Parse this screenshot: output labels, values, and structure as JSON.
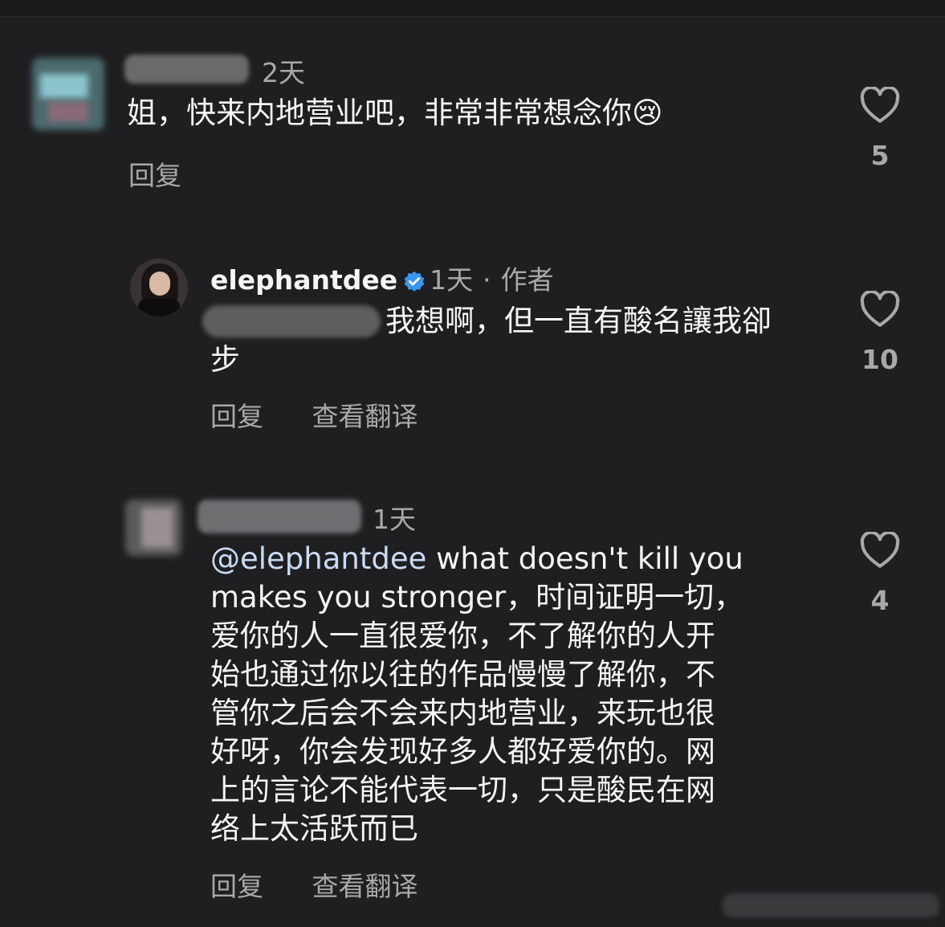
{
  "comments": [
    {
      "time": "2天",
      "text": "姐，快来内地营业吧，非常非常想念你",
      "emoji": "😢",
      "reply_label": "回复",
      "likes": "5"
    },
    {
      "username": "elephantdee",
      "time": "1天",
      "author_tag": "作者",
      "text": "我想啊，但一直有酸名讓我卻步",
      "reply_label": "回复",
      "translate_label": "查看翻译",
      "likes": "10"
    },
    {
      "time": "1天",
      "mention": "@elephantdee",
      "text_lines": [
        " what doesn't kill you",
        "makes you stronger，时间证明一切，",
        "爱你的人一直很爱你，不了解你的人开",
        "始也通过你以往的作品慢慢了解你，不",
        "管你之后会不会来内地营业，来玩也很",
        "好呀，你会发现好多人都好爱你的。网",
        "上的言论不能代表一切，只是酸民在网",
        "络上太活跃而已"
      ],
      "reply_label": "回复",
      "translate_label": "查看翻译",
      "likes": "4"
    }
  ],
  "icons": {
    "like": "heart-outline-icon",
    "verified": "verified-badge-icon"
  },
  "colors": {
    "background": "#1f1f21",
    "text": "#f5f5f5",
    "secondary": "#a8a8a8",
    "mention": "#c9dbf2",
    "verified": "#3897f0"
  }
}
